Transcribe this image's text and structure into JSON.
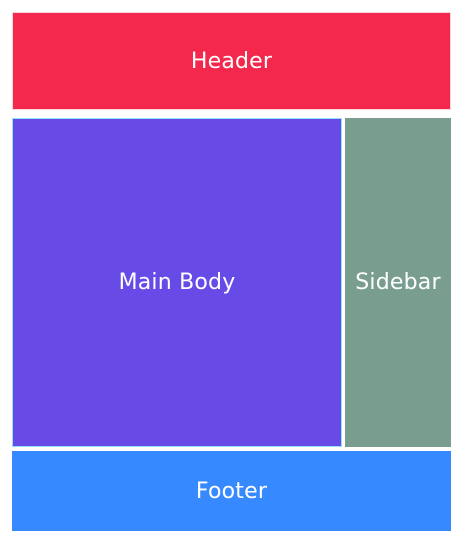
{
  "layout": {
    "header": {
      "label": "Header",
      "color": "#f4274d"
    },
    "main_body": {
      "label": "Main Body",
      "color": "#684ae7"
    },
    "sidebar": {
      "label": "Sidebar",
      "color": "#799e90"
    },
    "footer": {
      "label": "Footer",
      "color": "#3789ff"
    }
  }
}
